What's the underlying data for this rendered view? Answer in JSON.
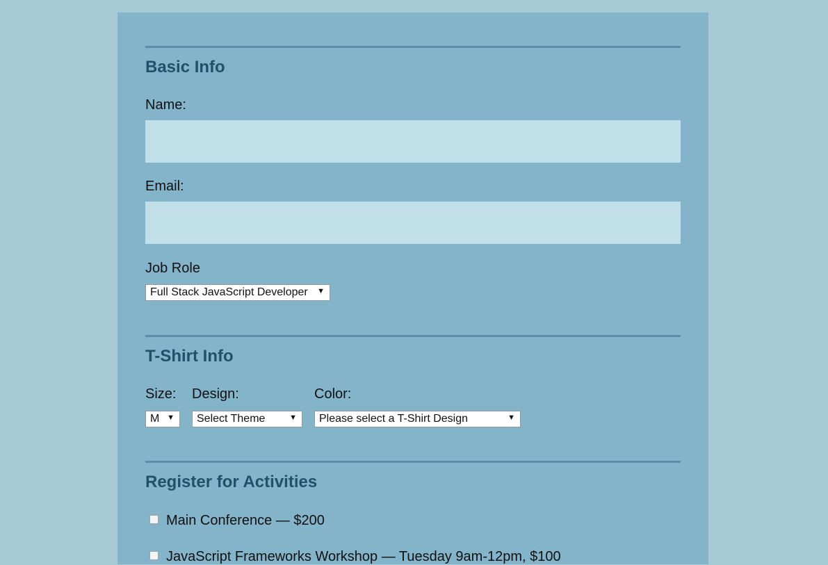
{
  "basic_info": {
    "title": "Basic Info",
    "name_label": "Name:",
    "name_value": "",
    "email_label": "Email:",
    "email_value": "",
    "job_role_label": "Job Role",
    "job_role_selected": "Full Stack JavaScript Developer"
  },
  "tshirt_info": {
    "title": "T-Shirt Info",
    "size_label": "Size:",
    "size_selected": "M",
    "design_label": "Design:",
    "design_selected": "Select Theme",
    "color_label": "Color:",
    "color_selected": "Please select a T-Shirt Design"
  },
  "activities": {
    "title": "Register for Activities",
    "items": [
      {
        "label": "Main Conference — $200",
        "checked": false
      },
      {
        "label": "JavaScript Frameworks Workshop — Tuesday 9am-12pm, $100",
        "checked": false
      }
    ]
  },
  "icons": {
    "dropdown": "▼"
  },
  "colors": {
    "page_background": "#a8cad7",
    "panel_background": "#84b4ca",
    "section_title": "#1f5268",
    "input_background": "#c0dfe9",
    "rule": "#5b8ea6"
  }
}
